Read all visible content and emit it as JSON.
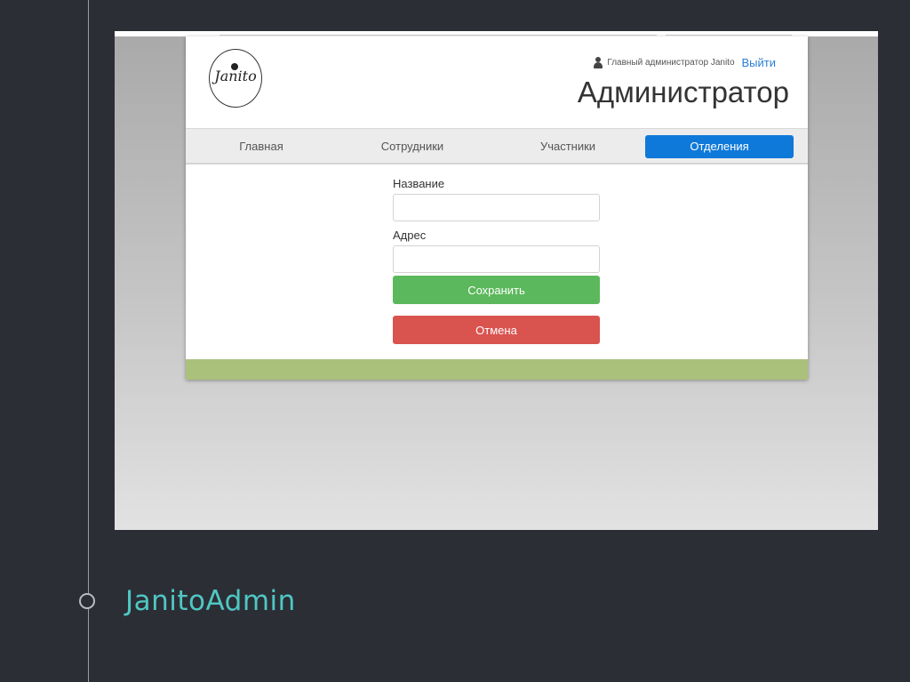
{
  "slide": {
    "caption": "JanitoAdmin"
  },
  "app": {
    "logo_text": "Janito",
    "user": {
      "name": "Главный администратор Janito",
      "logout_label": "Выйти"
    },
    "page_title": "Администратор",
    "nav": {
      "items": [
        {
          "label": "Главная",
          "active": false
        },
        {
          "label": "Сотрудники",
          "active": false
        },
        {
          "label": "Участники",
          "active": false
        },
        {
          "label": "Отделения",
          "active": true
        }
      ]
    },
    "form": {
      "name_label": "Название",
      "name_value": "",
      "address_label": "Адрес",
      "address_value": "",
      "save_label": "Сохранить",
      "cancel_label": "Отмена"
    }
  },
  "colors": {
    "slide_background": "#2c2e35",
    "caption": "#4fc7c4",
    "nav_active": "#0f79d9",
    "save_button": "#5cb85c",
    "cancel_button": "#d9534f",
    "footer": "#aac17c",
    "logout_link": "#2a7ed3"
  },
  "icons": {
    "user": "user-icon",
    "timeline_node": "circle-outline"
  }
}
